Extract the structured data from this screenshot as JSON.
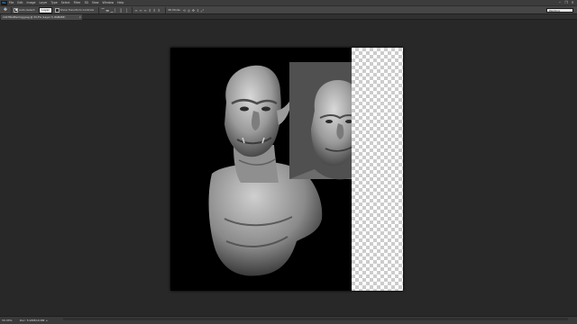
{
  "app": {
    "logo": "Ps"
  },
  "menu": [
    "File",
    "Edit",
    "Image",
    "Layer",
    "Type",
    "Select",
    "Filter",
    "3D",
    "View",
    "Window",
    "Help"
  ],
  "window_controls": [
    "minimize-icon",
    "restore-icon",
    "close-icon"
  ],
  "options_bar": {
    "tool_icon": "move-tool-icon",
    "auto_select_label": "Auto-Select:",
    "auto_select_checked": true,
    "auto_select_value": "Layer",
    "show_transform_label": "Show Transform Controls",
    "show_transform_checked": false,
    "align_icons": [
      "align-top-icon",
      "align-vcenter-icon",
      "align-bottom-icon",
      "align-left-icon",
      "align-hcenter-icon",
      "align-right-icon"
    ],
    "distribute_icons": [
      "dist-top-icon",
      "dist-vcenter-icon",
      "dist-bottom-icon",
      "dist-left-icon",
      "dist-hcenter-icon",
      "dist-right-icon"
    ],
    "mode_3d_label": "3D Mode:",
    "workspace": "Painting"
  },
  "document_tab": {
    "title": "119781Afterimg.jpeg @ 33.3% (Layer 3, RGB/8#)",
    "close": "×"
  },
  "status": {
    "zoom": "33.33%",
    "doc_size": "Doc: 5.93M/10.8M",
    "arrow": "▸"
  },
  "colors": {
    "canvas_bg": "#282828",
    "document_bg": "#000000",
    "accent": "#31a8ff"
  }
}
